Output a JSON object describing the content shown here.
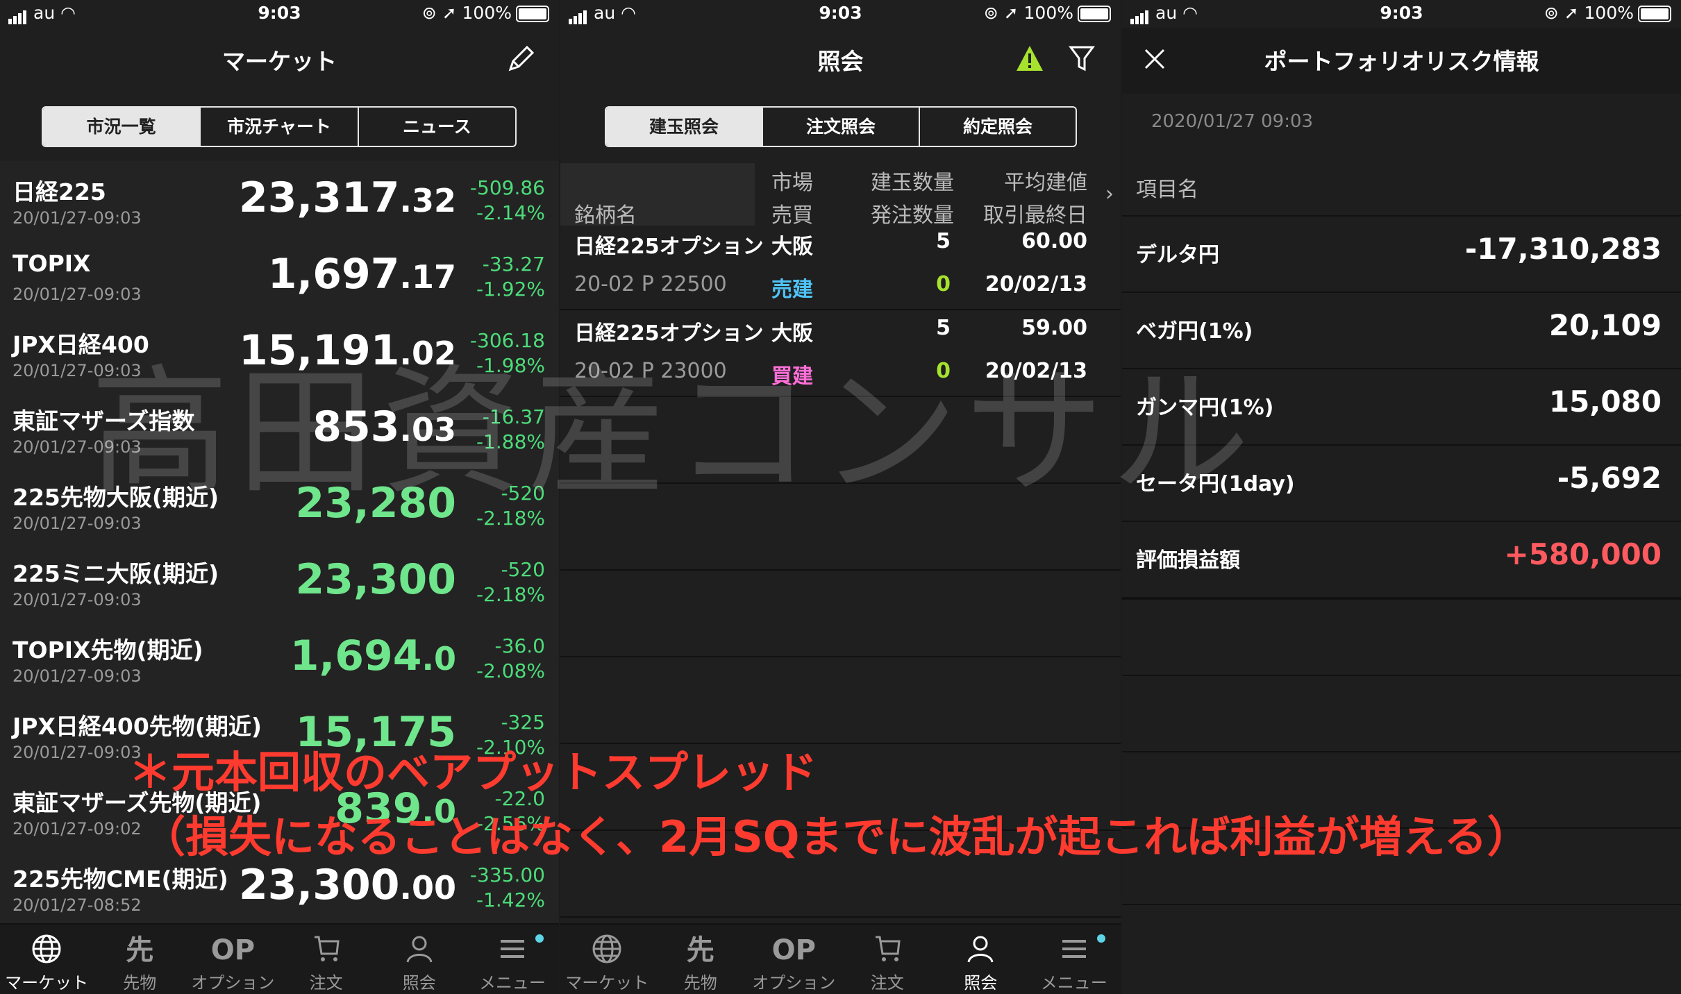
{
  "status": {
    "carrier": "au",
    "time": "9:03",
    "battery": "100%"
  },
  "market": {
    "title": "マーケット",
    "segments": [
      "市況一覧",
      "市況チャート",
      "ニュース"
    ],
    "rows": [
      {
        "name": "日経225",
        "date": "20/01/27-09:03",
        "int": "23,317",
        "dec": ".32",
        "chg": "-509.86",
        "pct": "-2.14%",
        "up": false
      },
      {
        "name": "TOPIX",
        "date": "20/01/27-09:03",
        "int": "1,697",
        "dec": ".17",
        "chg": "-33.27",
        "pct": "-1.92%",
        "up": false
      },
      {
        "name": "JPX日経400",
        "date": "20/01/27-09:03",
        "int": "15,191",
        "dec": ".02",
        "chg": "-306.18",
        "pct": "-1.98%",
        "up": false
      },
      {
        "name": "東証マザーズ指数",
        "date": "20/01/27-09:03",
        "int": "853",
        "dec": ".03",
        "chg": "-16.37",
        "pct": "-1.88%",
        "up": false
      },
      {
        "name": "225先物大阪(期近)",
        "date": "20/01/27-09:03",
        "int": "23,280",
        "dec": "",
        "chg": "-520",
        "pct": "-2.18%",
        "up": true
      },
      {
        "name": "225ミニ大阪(期近)",
        "date": "20/01/27-09:03",
        "int": "23,300",
        "dec": "",
        "chg": "-520",
        "pct": "-2.18%",
        "up": true
      },
      {
        "name": "TOPIX先物(期近)",
        "date": "20/01/27-09:03",
        "int": "1,694",
        "dec": ".0",
        "chg": "-36.0",
        "pct": "-2.08%",
        "up": true
      },
      {
        "name": "JPX日経400先物(期近)",
        "date": "20/01/27-09:03",
        "int": "15,175",
        "dec": "",
        "chg": "-325",
        "pct": "-2.10%",
        "up": true
      },
      {
        "name": "東証マザーズ先物(期近)",
        "date": "20/01/27-09:02",
        "int": "839",
        "dec": ".0",
        "chg": "-22.0",
        "pct": "-2.56%",
        "up": true
      },
      {
        "name": "225先物CME(期近)",
        "date": "20/01/27-08:52",
        "int": "23,300",
        "dec": ".00",
        "chg": "-335.00",
        "pct": "-1.42%",
        "up": false
      }
    ]
  },
  "tabs": [
    "マーケット",
    "先物",
    "オプション",
    "注文",
    "照会",
    "メニュー"
  ],
  "tab_icons": {
    "futures": "先",
    "option": "OP"
  },
  "inquiry": {
    "title": "照会",
    "segments": [
      "建玉照会",
      "注文照会",
      "約定照会"
    ],
    "headers": {
      "name": "銘柄名",
      "market": "市場",
      "side": "売買",
      "qty": "建玉数量",
      "order_qty": "発注数量",
      "avg": "平均建値",
      "last_day": "取引最終日"
    },
    "positions": [
      {
        "name": "日経225オプション",
        "market": "大阪",
        "qty": "5",
        "avg": "60.00",
        "code": "20-02 P 22500",
        "side": "売建",
        "order_qty": "0",
        "last_day": "20/02/13",
        "side_color": "#4fc3f7"
      },
      {
        "name": "日経225オプション",
        "market": "大阪",
        "qty": "5",
        "avg": "59.00",
        "code": "20-02 P 23000",
        "side": "買建",
        "order_qty": "0",
        "last_day": "20/02/13",
        "side_color": "#ff6fd8"
      }
    ]
  },
  "risk": {
    "title": "ポートフォリオリスク情報",
    "timestamp": "2020/01/27 09:03",
    "header": "項目名",
    "items": [
      {
        "label": "デルタ円",
        "value": "-17,310,283",
        "color": "#ffffff"
      },
      {
        "label": "ベガ円(1%)",
        "value": "20,109",
        "color": "#ffffff"
      },
      {
        "label": "ガンマ円(1%)",
        "value": "15,080",
        "color": "#ffffff"
      },
      {
        "label": "セータ円(1day)",
        "value": "-5,692",
        "color": "#ffffff"
      },
      {
        "label": "評価損益額",
        "value": "+580,000",
        "color": "#ff5a5f"
      }
    ]
  },
  "watermark": "高田資産コンサル",
  "annotation": {
    "line1": "＊元本回収のベアプットスプレッド",
    "line2": "（損失になることはなく、2月SQまでに波乱が起これば利益が増える）"
  }
}
